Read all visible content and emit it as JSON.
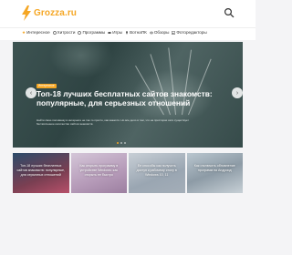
{
  "header": {
    "logo_text": "Grozza.ru",
    "logo_icon": "lightning-bolt-icon",
    "search_icon": "search-icon",
    "accent_color": "#f5a623"
  },
  "nav": {
    "items": [
      {
        "label": "Интересное",
        "icon": "star-icon"
      },
      {
        "label": "Хитрости",
        "icon": "gear-icon"
      },
      {
        "label": "Программы",
        "icon": "gear-icon"
      },
      {
        "label": "Игры",
        "icon": "gamepad-icon"
      },
      {
        "label": "ВотнаПК",
        "icon": "location-icon"
      },
      {
        "label": "Обзоры",
        "icon": "eye-icon"
      },
      {
        "label": "Фоторедакторы",
        "icon": "image-icon"
      }
    ]
  },
  "hero": {
    "badge": "Интересное",
    "title": "Топ-18 лучших бесплатных сайтов знакомств: популярные, для серьезных отношений",
    "description": "Найти свою половинку в интернете не так-то просто, как кажется. Но все дело в том, что на просторах сети существует бесчисленное количество сайтов знакомств.",
    "slides_total": 3,
    "active_slide": 1
  },
  "cards": [
    {
      "title": "Топ-18 лучших бесплатных сайтов знакомств: популярные, для серьезных отношений"
    },
    {
      "title": "Как открыть программу в устройстве Windows: как открыть ее быстро"
    },
    {
      "title": "Ее способы как получить доступ к рабочему столу в Windows 10, 11"
    },
    {
      "title": "Как отключить обновление программ на Андроид"
    }
  ]
}
